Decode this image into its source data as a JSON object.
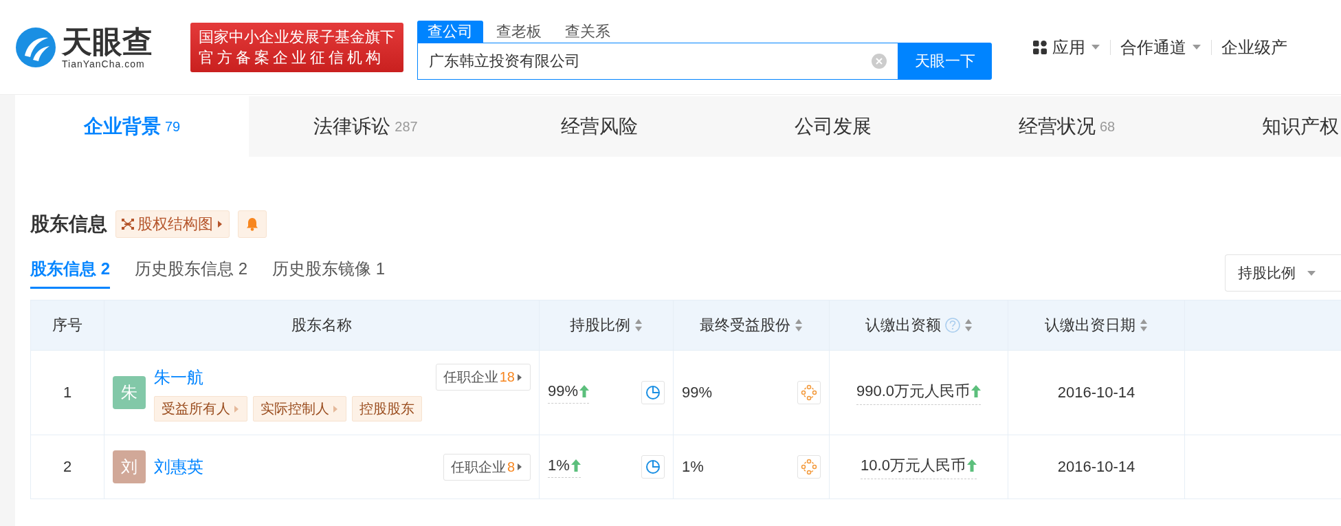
{
  "header": {
    "logo": {
      "name": "天眼查",
      "domain": "TianYanCha.com"
    },
    "badge_lines": [
      "国家中小企业发展子基金旗下",
      "官方备案企业征信机构"
    ],
    "search_tabs": [
      {
        "label": "查公司",
        "selected": true
      },
      {
        "label": "查老板",
        "selected": false
      },
      {
        "label": "查关系",
        "selected": false
      }
    ],
    "search": {
      "value": "广东韩立投资有限公司"
    },
    "search_button": "天眼一下",
    "nav": [
      {
        "label": "应用",
        "kind": "apps"
      },
      {
        "label": "合作通道",
        "kind": "dropdown"
      },
      {
        "label": "企业级产",
        "kind": "plain"
      }
    ]
  },
  "tabs": [
    {
      "label": "企业背景",
      "count": "79",
      "selected": true
    },
    {
      "label": "法律诉讼",
      "count": "287",
      "selected": false
    },
    {
      "label": "经营风险",
      "selected": false
    },
    {
      "label": "公司发展",
      "selected": false
    },
    {
      "label": "经营状况",
      "count": "68",
      "selected": false
    },
    {
      "label": "知识产权",
      "selected": false
    }
  ],
  "section": {
    "title": "股东信息",
    "structure_button": "股权结构图",
    "subtabs": [
      {
        "label": "股东信息 2",
        "selected": true
      },
      {
        "label": "历史股东信息 2",
        "selected": false
      },
      {
        "label": "历史股东镜像 1",
        "selected": false
      }
    ],
    "sort_select": "持股比例"
  },
  "table": {
    "columns": [
      {
        "label": "序号",
        "sortable": false,
        "help": false
      },
      {
        "label": "股东名称",
        "sortable": false,
        "help": false
      },
      {
        "label": "持股比例",
        "sortable": true,
        "help": false
      },
      {
        "label": "最终受益股份",
        "sortable": true,
        "help": false
      },
      {
        "label": "认缴出资额",
        "sortable": true,
        "help": true
      },
      {
        "label": "认缴出资日期",
        "sortable": true,
        "help": false
      }
    ],
    "rows": [
      {
        "index": "1",
        "avatar": "朱",
        "color": "#82c8a8",
        "name": "朱一航",
        "jobs_label": "任职企业",
        "jobs_count": "18",
        "tags": [
          {
            "label": "受益所有人",
            "has_arrow": true
          },
          {
            "label": "实际控制人",
            "has_arrow": true
          },
          {
            "label": "控股股东",
            "has_arrow": false
          }
        ],
        "share": "99%",
        "share_up": true,
        "ultimate": "99%",
        "capital": "990.0万元人民币",
        "capital_up": true,
        "date": "2016-10-14"
      },
      {
        "index": "2",
        "avatar": "刘",
        "color": "#d1a898",
        "name": "刘惠英",
        "jobs_label": "任职企业",
        "jobs_count": "8",
        "tags": [],
        "share": "1%",
        "share_up": true,
        "ultimate": "1%",
        "capital": "10.0万元人民币",
        "capital_up": true,
        "date": "2016-10-14"
      }
    ]
  }
}
